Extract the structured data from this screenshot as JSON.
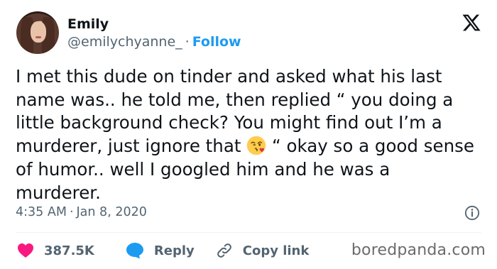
{
  "author": {
    "name": "Emily",
    "handle": "@emilychyanne_",
    "separator": "·",
    "follow_label": "Follow"
  },
  "tweet": {
    "text_before_emoji": "I met this dude on tinder and asked what his last name was.. he told me, then replied “ you doing a little background check? You might find out I’m a murderer, just ignore that ",
    "emoji": "face-blowing-kiss",
    "text_after_emoji": " “ okay so a good sense of humor.. well I googled him and he was a murderer."
  },
  "timestamp": {
    "time": "4:35 AM",
    "separator": "·",
    "date": "Jan 8, 2020"
  },
  "actions": {
    "likes": "387.5K",
    "reply_label": "Reply",
    "copy_link_label": "Copy link"
  },
  "watermark": "boredpanda.com",
  "colors": {
    "accent": "#1d9bf0",
    "like": "#f91880",
    "muted": "#536471",
    "text": "#0f1419"
  }
}
